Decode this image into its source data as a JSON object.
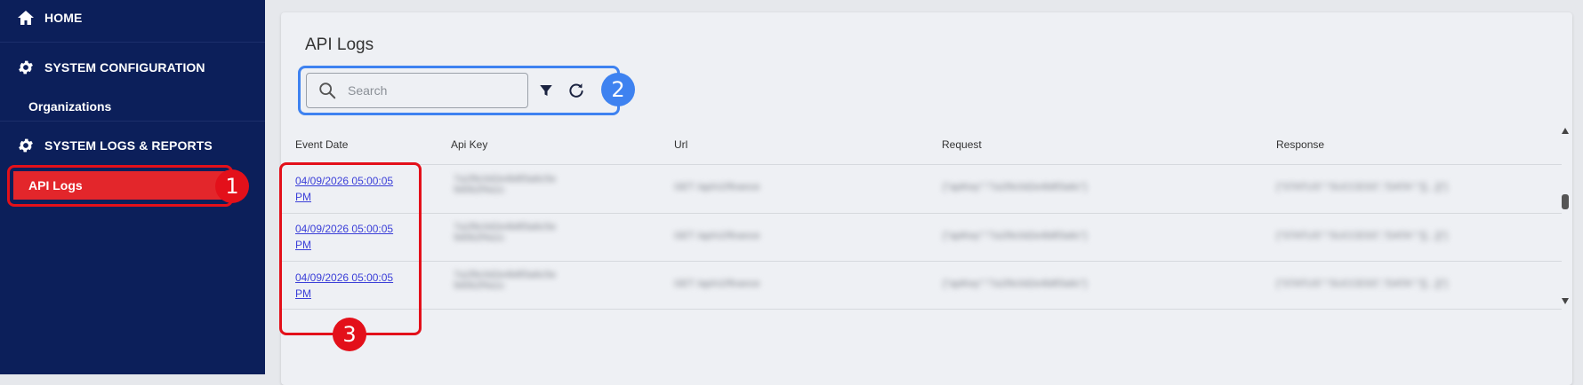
{
  "sidebar": {
    "home_label": "HOME",
    "sysconfig_label": "SYSTEM CONFIGURATION",
    "organizations_label": "Organizations",
    "syslogs_label": "SYSTEM LOGS & REPORTS",
    "apilogs_label": "API Logs"
  },
  "page": {
    "title": "API Logs",
    "search_placeholder": "Search"
  },
  "table": {
    "headers": [
      "Event Date",
      "Api Key",
      "Url",
      "Request",
      "Response"
    ],
    "rows": [
      {
        "date_line1": "04/09/2026 05:00:05",
        "date_line2": "PM",
        "api_key_line1": "7a1f9c0d2e4b8f3a6c5e",
        "api_key_line2": "9d0b2f4a1c",
        "url": "GET /api/v2/finance",
        "request": "{\"apiKey\":\"7a1f9c0d2e4b8f3a6c\"}",
        "response": "{\"STATUS\":\"SUCCESS\",\"DATA\":\"[{...}]\"}"
      },
      {
        "date_line1": "04/09/2026 05:00:05",
        "date_line2": "PM",
        "api_key_line1": "7a1f9c0d2e4b8f3a6c5e",
        "api_key_line2": "9d0b2f4a1c",
        "url": "GET /api/v2/finance",
        "request": "{\"apiKey\":\"7a1f9c0d2e4b8f3a6c\"}",
        "response": "{\"STATUS\":\"SUCCESS\",\"DATA\":\"[{...}]\"}"
      },
      {
        "date_line1": "04/09/2026 05:00:05",
        "date_line2": "PM",
        "api_key_line1": "7a1f9c0d2e4b8f3a6c5e",
        "api_key_line2": "9d0b2f4a1c",
        "url": "GET /api/v2/finance",
        "request": "{\"apiKey\":\"7a1f9c0d2e4b8f3a6c\"}",
        "response": "{\"STATUS\":\"SUCCESS\",\"DATA\":\"[{...}]\"}"
      }
    ]
  },
  "callouts": [
    {
      "number": "1",
      "color": "#e3101a"
    },
    {
      "number": "2",
      "color": "#3e82f0"
    },
    {
      "number": "3",
      "color": "#e3101a"
    }
  ],
  "icons": {
    "home": "home-icon",
    "gear": "gear-icon",
    "search": "search-icon",
    "filter": "filter-icon",
    "refresh": "refresh-icon"
  },
  "colors": {
    "sidebar_bg": "#0c1f5a",
    "active_item": "#e3262b",
    "link": "#3b3fd8"
  }
}
